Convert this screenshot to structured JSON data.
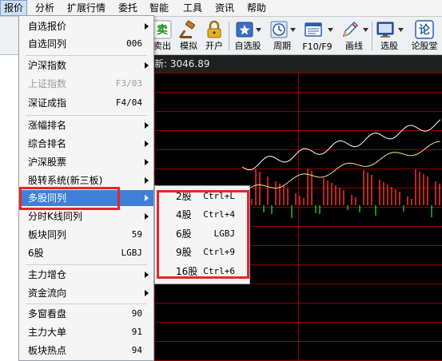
{
  "menubar": {
    "items": [
      {
        "label": "报价",
        "active": true
      },
      {
        "label": "分析"
      },
      {
        "label": "扩展行情"
      },
      {
        "label": "委托"
      },
      {
        "label": "智能"
      },
      {
        "label": "工具"
      },
      {
        "label": "资讯"
      },
      {
        "label": "帮助"
      }
    ]
  },
  "toolbar": {
    "items": [
      {
        "label": "卖出",
        "icon": "sell-icon",
        "glyph": "卖"
      },
      {
        "label": "模拟",
        "icon": "gavel-icon"
      },
      {
        "label": "开户",
        "icon": "lock-icon"
      },
      {
        "label": "自选股",
        "icon": "star-folder-icon"
      },
      {
        "label": "周期",
        "icon": "clock-icon"
      },
      {
        "label": "F10/F9",
        "icon": "document-icon"
      },
      {
        "label": "画线",
        "icon": "pencil-icon"
      },
      {
        "label": "选股",
        "icon": "monitor-icon"
      },
      {
        "label": "论股堂",
        "icon": "forum-icon",
        "glyph": "论"
      }
    ]
  },
  "chart": {
    "header_label": "新: 3046.89",
    "colors": {
      "background": "#000000",
      "grid": "#8b0000",
      "price_line": "#ffffff",
      "avg_line": "#f0e68c",
      "up_bar": "#ff3030",
      "down_bar": "#20c020"
    }
  },
  "menu": {
    "items": [
      {
        "label": "自选报价",
        "shortcut": "",
        "arrow": true
      },
      {
        "label": "自选同列",
        "shortcut": "006",
        "arrow": false
      },
      {
        "label": "沪深指数",
        "shortcut": "",
        "arrow": true
      },
      {
        "label": "上证指数",
        "shortcut": "F3/03",
        "arrow": false,
        "disabled": true
      },
      {
        "label": "深证成指",
        "shortcut": "F4/04",
        "arrow": false
      },
      {
        "label": "涨幅排名",
        "shortcut": "",
        "arrow": true
      },
      {
        "label": "综合排名",
        "shortcut": "",
        "arrow": true
      },
      {
        "label": "沪深股票",
        "shortcut": "",
        "arrow": true
      },
      {
        "label": "股转系统(新三板)",
        "shortcut": "",
        "arrow": true
      },
      {
        "label": "多股同列",
        "shortcut": "",
        "arrow": true,
        "highlight": true
      },
      {
        "label": "分时K线同列",
        "shortcut": "",
        "arrow": true
      },
      {
        "label": "板块同列",
        "shortcut": "59",
        "arrow": false
      },
      {
        "label": "6股",
        "shortcut": "LGBJ",
        "arrow": false
      },
      {
        "label": "主力增仓",
        "shortcut": "",
        "arrow": true
      },
      {
        "label": "资金流向",
        "shortcut": "",
        "arrow": true
      },
      {
        "label": "多窗看盘",
        "shortcut": "90",
        "arrow": false
      },
      {
        "label": "主力大单",
        "shortcut": "91",
        "arrow": false
      },
      {
        "label": "板块热点",
        "shortcut": "94",
        "arrow": false
      }
    ]
  },
  "submenu": {
    "items": [
      {
        "label": "2股",
        "shortcut": "Ctrl+L"
      },
      {
        "label": "4股",
        "shortcut": "Ctrl+4"
      },
      {
        "label": "6股",
        "shortcut": "LGBJ"
      },
      {
        "label": "9股",
        "shortcut": "Ctrl+9"
      },
      {
        "label": "16股",
        "shortcut": "Ctrl+6"
      }
    ]
  }
}
